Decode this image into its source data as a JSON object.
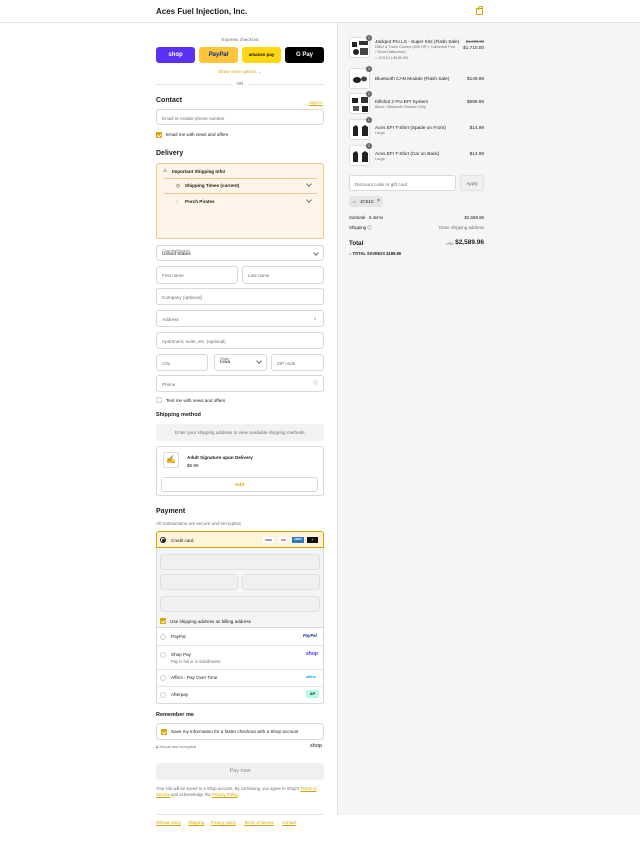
{
  "header": {
    "brand": "Aces Fuel Injection, Inc."
  },
  "express": {
    "title": "Express checkout",
    "buttons": [
      "shop",
      "PayPal",
      "amazon pay",
      "G Pay"
    ],
    "more": "Show more options",
    "or": "OR"
  },
  "contact": {
    "title": "Contact",
    "signin": "Sign in",
    "placeholder": "Email or mobile phone number",
    "news": "Email me with news and offers"
  },
  "delivery": {
    "title": "Delivery",
    "notice_title": "Important Shipping Info!",
    "notice_items": [
      "Shipping Times (current)",
      "Porch Pirates"
    ],
    "country_label": "Country/Region",
    "country": "United States",
    "first_name": "First name",
    "last_name": "Last name",
    "company": "Company (optional)",
    "address": "Address",
    "apartment": "Apartment, suite, etc. (optional)",
    "city": "City",
    "state_label": "State",
    "state": "Iowa",
    "zip": "ZIP code",
    "phone": "Phone",
    "text_news": "Text me with news and offers"
  },
  "shipping": {
    "title": "Shipping method",
    "hint": "Enter your shipping address to view available shipping methods.",
    "addon_title": "Adult Signature upon Delivery",
    "addon_price": "$6.99",
    "add": "Add"
  },
  "payment": {
    "title": "Payment",
    "subtitle": "All transactions are secure and encrypted.",
    "credit_card": "Credit card",
    "card_brands": [
      "VISA",
      "MC",
      "AMEX",
      "+"
    ],
    "billing": "Use shipping address as billing address",
    "options": [
      {
        "label": "PayPal",
        "logo": "PayPal"
      },
      {
        "label": "Shop Pay",
        "sub": "Pay in full or in installments",
        "logo": "shop"
      },
      {
        "label": "Affirm - Pay Over Time",
        "logo": "affirm"
      },
      {
        "label": "Afterpay",
        "logo": "AP"
      }
    ]
  },
  "remember": {
    "title": "Remember me",
    "save": "Save my information for a faster checkout with a Shop account",
    "secure": "Secure and encrypted",
    "shop": "shop",
    "pay": "Pay now",
    "legal_prefix": "Your info will be saved to a Shop account. By continuing, you agree to Shop's",
    "terms": "Terms of Service",
    "and": "and acknowledge the",
    "privacy": "Privacy Policy"
  },
  "footer": [
    "Refund policy",
    "Shipping",
    "Privacy policy",
    "Terms of service",
    "Contact"
  ],
  "cart": {
    "items": [
      {
        "qty": "1",
        "name": "Jackpot Pro LS - Super Kits (Flash Sale)",
        "desc1": "DBW & Trans Control (500 HP) / Cathedral Port",
        "desc2": "/ Short Datbucket)",
        "discount": "JCS10 (-$189.99)",
        "old_price": "$1,899.99",
        "price": "$1,710.00"
      },
      {
        "qty": "1",
        "name": "Bluetooth CAN Module (Flash Sale)",
        "desc1": "",
        "price": "$149.99"
      },
      {
        "qty": "1",
        "name": "Killshot 2 Pro EFI System",
        "desc1": "Black / Bluetooth Module Only",
        "price": "$699.99"
      },
      {
        "qty": "1",
        "name": "Aces EFI T-Shirt (Spade on Front)",
        "desc1": "Large",
        "price": "$14.99"
      },
      {
        "qty": "1",
        "name": "Aces EFI T-Shirt (Car on Back)",
        "desc1": "Large",
        "price": "$14.99"
      }
    ],
    "discount_placeholder": "Discount code or gift card",
    "apply": "Apply",
    "code": "JCS10",
    "subtotal_label": "Subtotal · 5 items",
    "subtotal": "$2,589.96",
    "shipping_label": "Shipping",
    "shipping_value": "Enter shipping address",
    "total_label": "Total",
    "currency": "USD",
    "total": "$2,589.96",
    "savings_label": "TOTAL SAVINGS",
    "savings": "$189.99"
  }
}
